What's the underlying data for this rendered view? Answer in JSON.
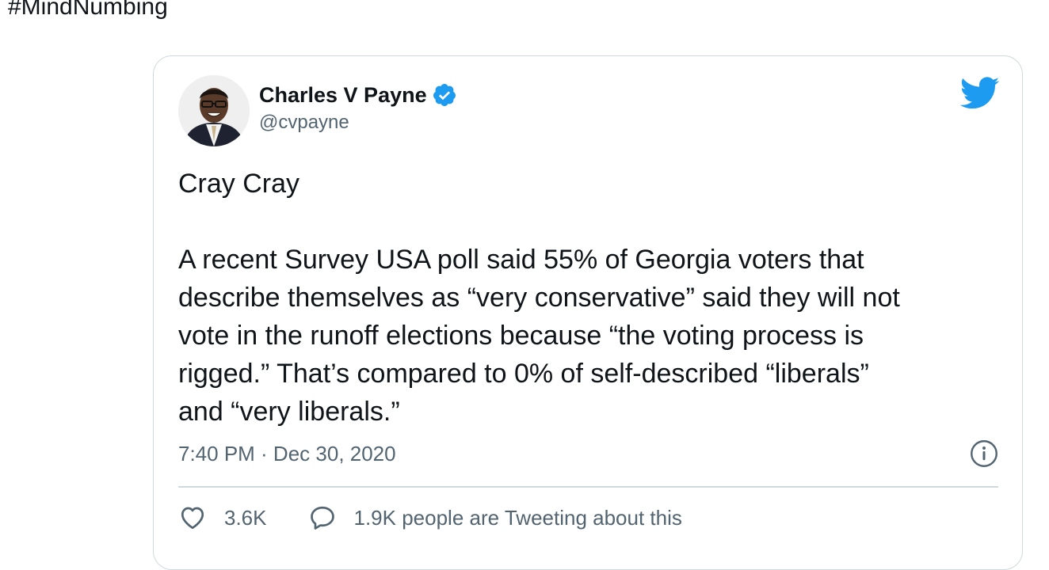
{
  "intro": {
    "hashtag": "#MindNumbing"
  },
  "tweet": {
    "author_name": "Charles V Payne",
    "author_handle": "@cvpayne",
    "verified": true,
    "text_line_1": "Cray Cray",
    "text_body": "A recent Survey USA poll said 55% of Georgia voters that\ndescribe themselves as “very conservative” said they will not\nvote in the runoff elections because “the voting process is\nrigged.” That’s compared to 0% of self-described “liberals”\nand “very liberals.”",
    "timestamp": "7:40 PM · Dec 30, 2020",
    "like_count": "3.6K",
    "conversation_text": "1.9K people are Tweeting about this"
  },
  "icons": {
    "brand": "twitter-bird-icon",
    "verified": "verified-badge-icon",
    "info": "info-icon",
    "like": "heart-icon",
    "reply": "speech-bubble-icon"
  },
  "colors": {
    "brand_blue": "#1d9bf0",
    "text_primary": "#0f1419",
    "text_secondary": "#536471",
    "border": "#cfd9de"
  }
}
